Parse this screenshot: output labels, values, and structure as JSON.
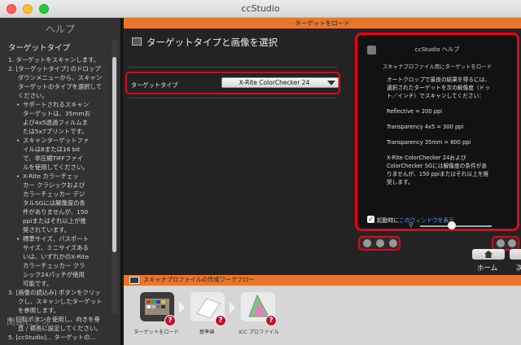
{
  "window": {
    "title": "ccStudio"
  },
  "help_panel": {
    "heading": "ヘルプ",
    "topic": "ターゲットタイプ",
    "lines": [
      {
        "text": "1. ターゲットをスキャンします。",
        "level": 0
      },
      {
        "text": "2. [ターゲットタイプ] のドロップ",
        "level": 0
      },
      {
        "text": "ダウンメニューから、スキャン",
        "level": 1
      },
      {
        "text": "ターゲットのタイプを選択して",
        "level": 1
      },
      {
        "text": "ください。",
        "level": 1
      },
      {
        "text": "サポートされるスキャン",
        "level": 2,
        "bullet": true
      },
      {
        "text": "ターゲットは、35mmお",
        "level": 2
      },
      {
        "text": "よび4x5透過フィルムま",
        "level": 2
      },
      {
        "text": "たは5x7プリントです。",
        "level": 2
      },
      {
        "text": "スキャンターゲットファ",
        "level": 2,
        "bullet": true
      },
      {
        "text": "イルは8または16 bit",
        "level": 2
      },
      {
        "text": "で、非圧縮TIFFファイ",
        "level": 2
      },
      {
        "text": "ルを使用してください。",
        "level": 2
      },
      {
        "text": "X-Rite カラーチェッ",
        "level": 2,
        "bullet": true
      },
      {
        "text": "カー クラシックおよび",
        "level": 2
      },
      {
        "text": "カラーチェッカー デジ",
        "level": 2
      },
      {
        "text": "タルSGには解像度の条",
        "level": 2
      },
      {
        "text": "件がありませんが、150",
        "level": 2
      },
      {
        "text": "ppiまたはそれ以上が推",
        "level": 2
      },
      {
        "text": "奨されています。",
        "level": 2
      },
      {
        "text": "標準サイズ、パスポート",
        "level": 2,
        "bullet": true
      },
      {
        "text": "サイズ、ミニサイズある",
        "level": 2
      },
      {
        "text": "いは、いずれかのX-Rite",
        "level": 2
      },
      {
        "text": "カラーチェッカー クラ",
        "level": 2
      },
      {
        "text": "シック24パッチが使用",
        "level": 2
      },
      {
        "text": "可能です。",
        "level": 2
      },
      {
        "text": "3. [画像の読込み] ボタンをクリッ",
        "level": 0
      },
      {
        "text": "クし、スキャンしたターゲット",
        "level": 1
      },
      {
        "text": "を参照します。",
        "level": 1
      },
      {
        "text": "4. 回転ボタンを使用し、向きを垂",
        "level": 0
      },
      {
        "text": "直 / 横長に設定してください。",
        "level": 1
      },
      {
        "text": "5. [ccStudio]... ターゲットの...",
        "level": 0
      }
    ],
    "related_video": "関連ビデオ"
  },
  "main": {
    "banner": "ターゲットをロード",
    "step_title": "ターゲットタイプと画像を選択",
    "target_type_label": "ターゲットタイプ",
    "target_type_value": "X-Rite ColorChecker 24"
  },
  "help_dialog": {
    "title": "ccStudio ヘルプ",
    "subtitle": "スキャナプロファイル用にターゲットをロード",
    "intro": "オートクロップで最良の結果を得るには、選択されたターゲットを次の解像度（ドット／インチ）でスキャンしてください：",
    "items": [
      "Reflective = 200 ppi",
      "Transparency 4x5 = 300 ppi",
      "Transparency 35mm = 800 ppi",
      "X-Rite ColorChecker 24およびColorChecker SGには解像度の条件がありませんが、150 ppiまたはそれ以上を推奨します。"
    ],
    "checkbox_checked": true,
    "checkbox_label_prefix": "起動時に",
    "checkbox_label_link": "このウィンドウを表示"
  },
  "nav": {
    "home_label": "ホーム",
    "next_label": "次"
  },
  "workflow": {
    "banner": "スキャナプロファイルの作成ワークフロー",
    "steps": [
      {
        "label": "ターゲットをロード",
        "selected": true
      },
      {
        "label": "基準値",
        "selected": false
      },
      {
        "label": "ICC プロファイル",
        "selected": false
      }
    ],
    "help_badge": "?"
  },
  "colors": {
    "accent_orange": "#e8762b",
    "highlight_red": "#e30613",
    "link_blue": "#4aa3ff"
  }
}
